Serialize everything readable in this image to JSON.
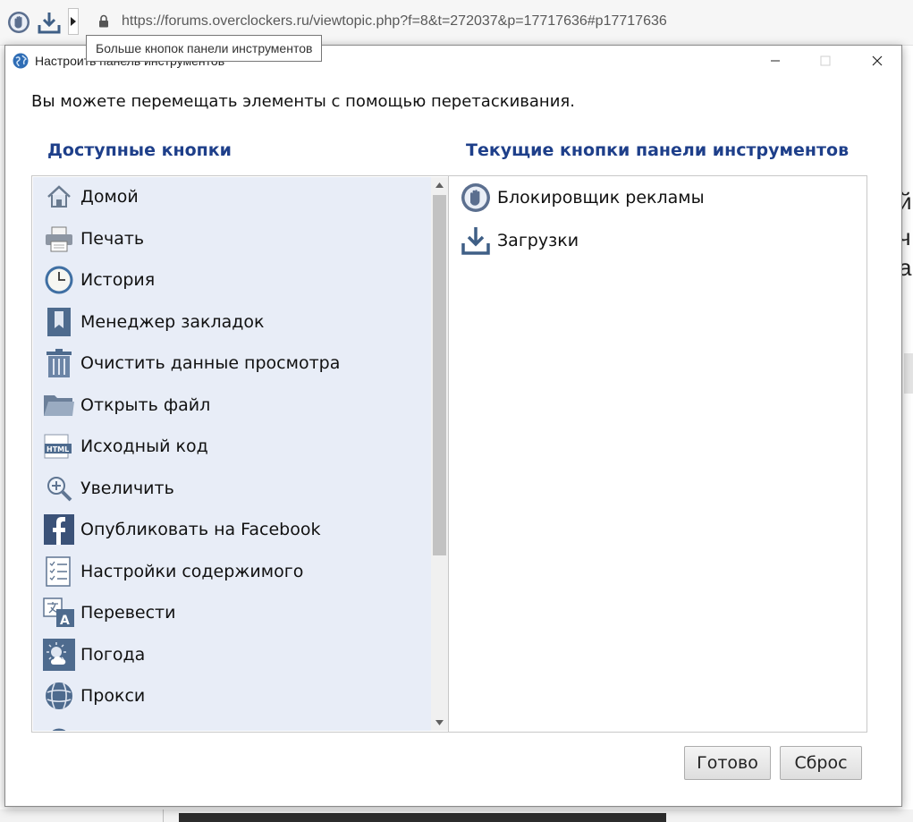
{
  "browser": {
    "url": "https://forums.overclockers.ru/viewtopic.php?f=8&t=272037&p=17717636#p17717636",
    "tooltip": "Больше кнопок панели инструментов",
    "bg_fragments": [
      "й",
      "ч",
      "а"
    ]
  },
  "dialog": {
    "title": "Настроить панель инструментов",
    "instruction": "Вы можете перемещать элементы с помощью перетаскивания.",
    "available_header": "Доступные кнопки",
    "current_header": "Текущие кнопки панели инструментов",
    "available_items": [
      {
        "label": "Домой",
        "icon": "home-icon"
      },
      {
        "label": "Печать",
        "icon": "print-icon"
      },
      {
        "label": "История",
        "icon": "history-icon"
      },
      {
        "label": "Менеджер закладок",
        "icon": "bookmarks-icon"
      },
      {
        "label": "Очистить данные просмотра",
        "icon": "trash-icon"
      },
      {
        "label": "Открыть файл",
        "icon": "folder-icon"
      },
      {
        "label": "Исходный код",
        "icon": "html-icon"
      },
      {
        "label": "Увеличить",
        "icon": "zoom-icon"
      },
      {
        "label": "Опубликовать на Facebook",
        "icon": "facebook-icon"
      },
      {
        "label": "Настройки содержимого",
        "icon": "settings-list-icon"
      },
      {
        "label": "Перевести",
        "icon": "translate-icon"
      },
      {
        "label": "Погода",
        "icon": "weather-icon"
      },
      {
        "label": "Прокси",
        "icon": "proxy-icon"
      }
    ],
    "current_items": [
      {
        "label": "Блокировщик рекламы",
        "icon": "adblock-icon"
      },
      {
        "label": "Загрузки",
        "icon": "download-icon"
      }
    ],
    "buttons": {
      "done": "Готово",
      "reset": "Сброс"
    }
  }
}
